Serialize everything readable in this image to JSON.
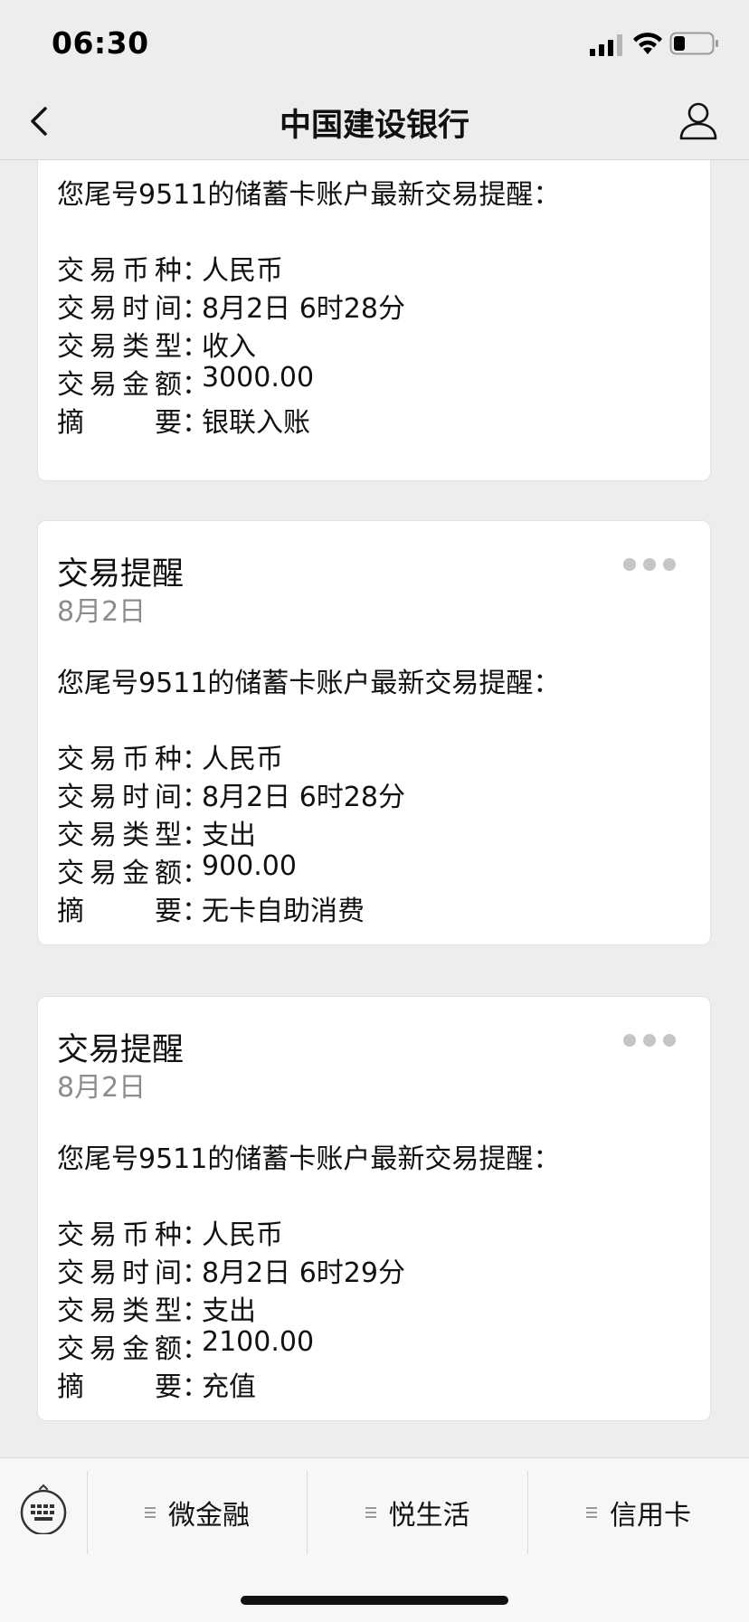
{
  "status_bar": {
    "time": "06:30"
  },
  "nav": {
    "title": "中国建设银行"
  },
  "cards": [
    {
      "intro": "您尾号9511的储蓄卡账户最新交易提醒：",
      "rows": [
        {
          "label": "交易币种",
          "value": "人民币"
        },
        {
          "label": "交易时间",
          "value": "8月2日 6时28分"
        },
        {
          "label": "交易类型",
          "value": "收入"
        },
        {
          "label": "交易金额",
          "value": "3000.00"
        },
        {
          "label": "摘要",
          "value": "银联入账"
        }
      ]
    },
    {
      "title": "交易提醒",
      "date": "8月2日",
      "intro": "您尾号9511的储蓄卡账户最新交易提醒：",
      "rows": [
        {
          "label": "交易币种",
          "value": "人民币"
        },
        {
          "label": "交易时间",
          "value": "8月2日 6时28分"
        },
        {
          "label": "交易类型",
          "value": "支出"
        },
        {
          "label": "交易金额",
          "value": "900.00"
        },
        {
          "label": "摘要",
          "value": "无卡自助消费"
        }
      ]
    },
    {
      "title": "交易提醒",
      "date": "8月2日",
      "intro": "您尾号9511的储蓄卡账户最新交易提醒：",
      "rows": [
        {
          "label": "交易币种",
          "value": "人民币"
        },
        {
          "label": "交易时间",
          "value": "8月2日 6时29分"
        },
        {
          "label": "交易类型",
          "value": "支出"
        },
        {
          "label": "交易金额",
          "value": "2100.00"
        },
        {
          "label": "摘要",
          "value": "充值"
        }
      ]
    }
  ],
  "colon": "：",
  "bottom_menu": {
    "items": [
      {
        "label": "微金融"
      },
      {
        "label": "悦生活"
      },
      {
        "label": "信用卡"
      }
    ]
  },
  "icons": {
    "back": "chevron-left-icon",
    "profile": "person-icon",
    "more": "ellipsis-icon",
    "keyboard": "keyboard-icon",
    "menu": "menu-lines-icon"
  },
  "colors": {
    "background": "#ededed",
    "card": "#ffffff",
    "date_text": "#8c8c8c"
  }
}
